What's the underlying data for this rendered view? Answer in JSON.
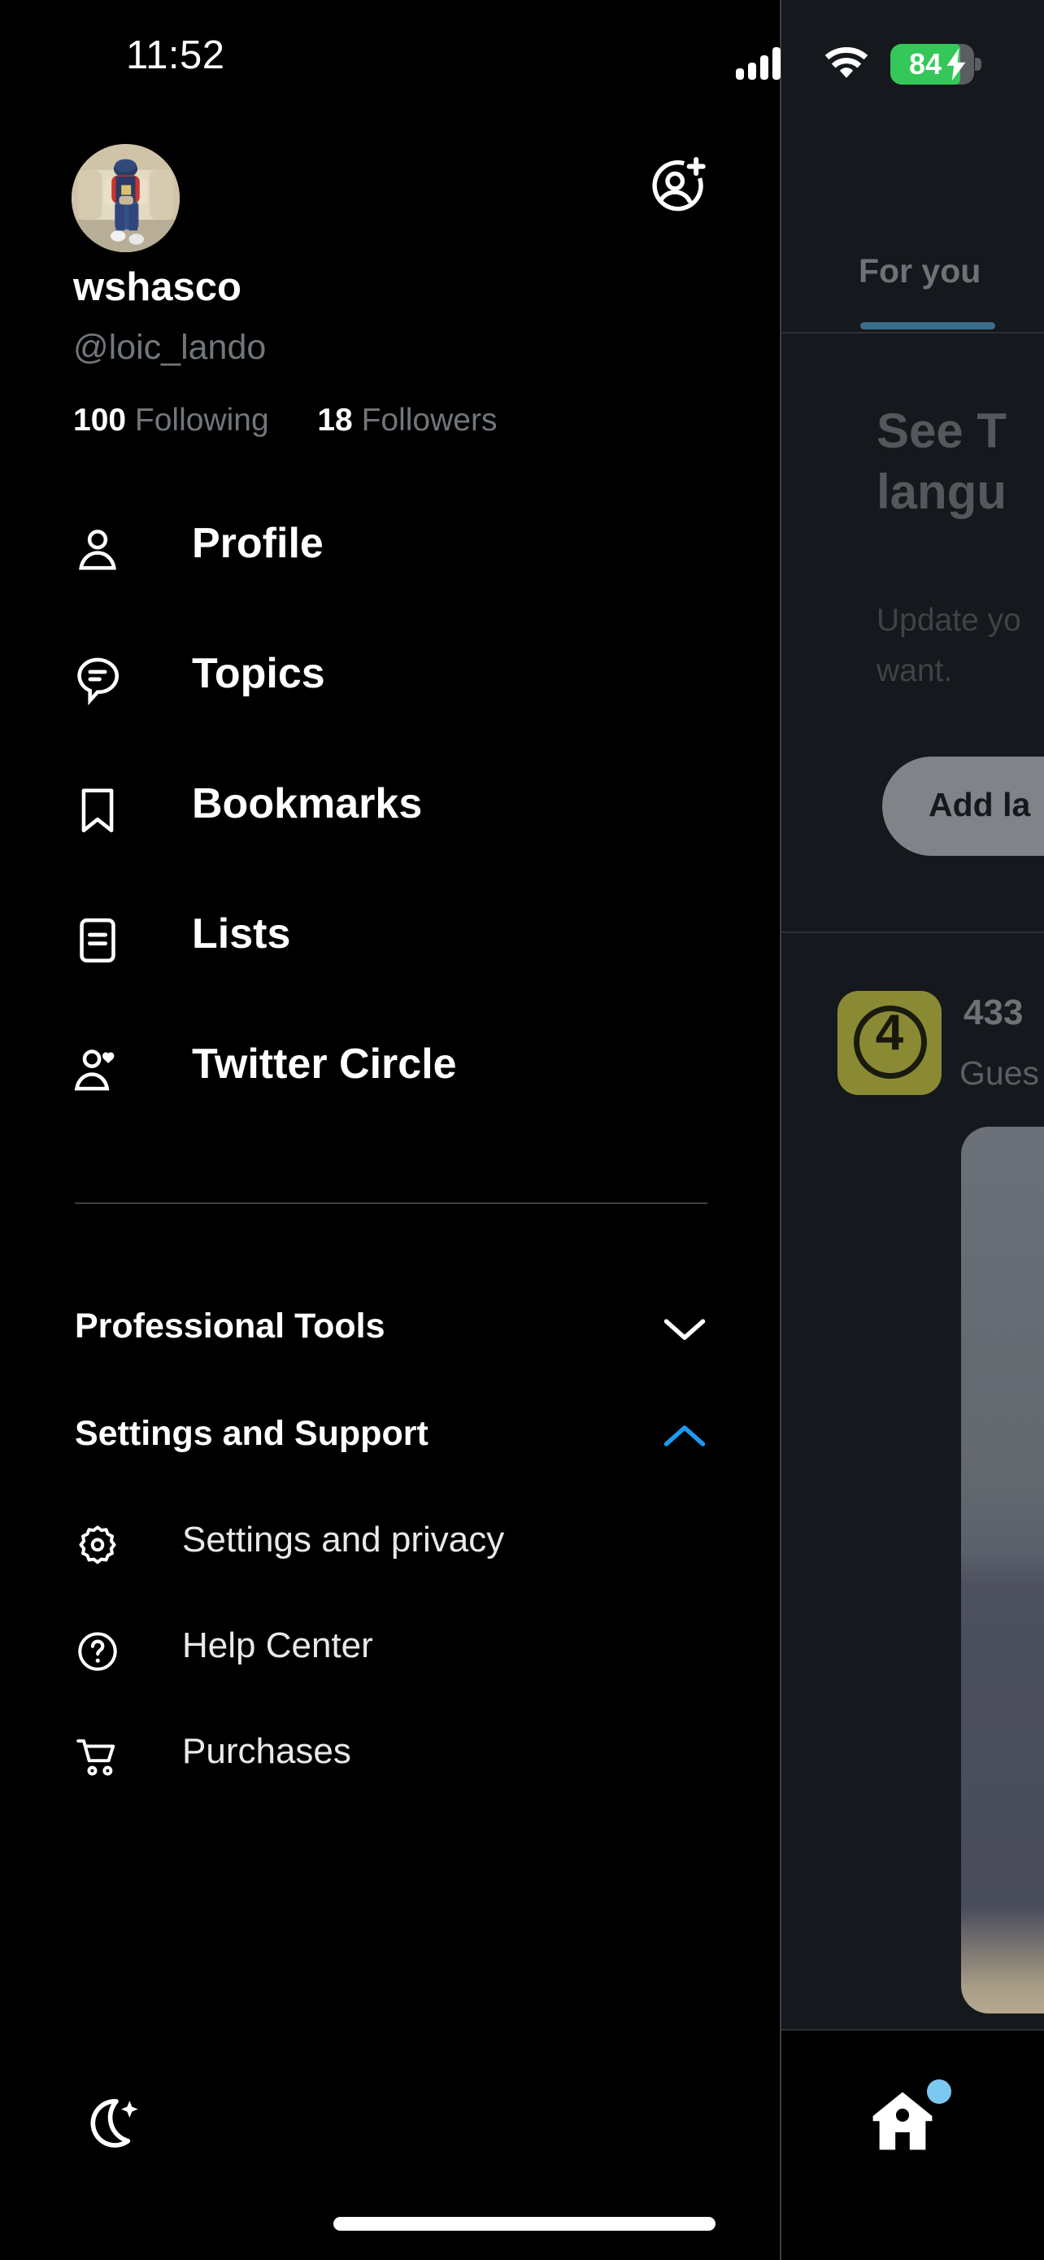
{
  "status_bar": {
    "time": "11:52",
    "battery_percent": "84",
    "battery_color": "#34c759",
    "cellular_icon": "signal-bars-icon",
    "wifi_icon": "wifi-icon",
    "battery_icon": "battery-charging-icon"
  },
  "drawer": {
    "avatar": {
      "icon": "user-avatar",
      "alt": "person sitting on beige couch"
    },
    "add_account_icon": "add-account-icon",
    "display_name": "wshasco",
    "handle": "@loic_lando",
    "following_count": "100",
    "following_label": "Following",
    "followers_count": "18",
    "followers_label": "Followers",
    "menu_items": [
      {
        "label": "Profile",
        "icon": "person-icon"
      },
      {
        "label": "Topics",
        "icon": "topics-bubble-icon"
      },
      {
        "label": "Bookmarks",
        "icon": "bookmark-icon"
      },
      {
        "label": "Lists",
        "icon": "lists-icon"
      },
      {
        "label": "Twitter Circle",
        "icon": "person-heart-icon"
      }
    ],
    "sections": [
      {
        "label": "Professional Tools",
        "chevron": "chevron-down-icon",
        "expanded": false,
        "chevron_color": "#ffffff"
      },
      {
        "label": "Settings and Support",
        "chevron": "chevron-up-icon",
        "expanded": true,
        "chevron_color": "#1d9bf0"
      }
    ],
    "sub_items": [
      {
        "label": "Settings and privacy",
        "icon": "gear-icon"
      },
      {
        "label": "Help Center",
        "icon": "question-circle-icon"
      },
      {
        "label": "Purchases",
        "icon": "shopping-cart-icon"
      }
    ],
    "theme_toggle_icon": "moon-sparkle-icon"
  },
  "background": {
    "tab_label": "For you",
    "tab_underline_color": "#3a6d8c",
    "headline": "See T\nlangu",
    "subtext": "Update yo\nwant.",
    "button_label": "Add la",
    "post": {
      "avatar_badge": "4",
      "avatar_color": "#8a8a35",
      "author": "433",
      "handle": "Gues"
    },
    "home_icon": "home-icon",
    "home_badge": "notification-dot"
  }
}
